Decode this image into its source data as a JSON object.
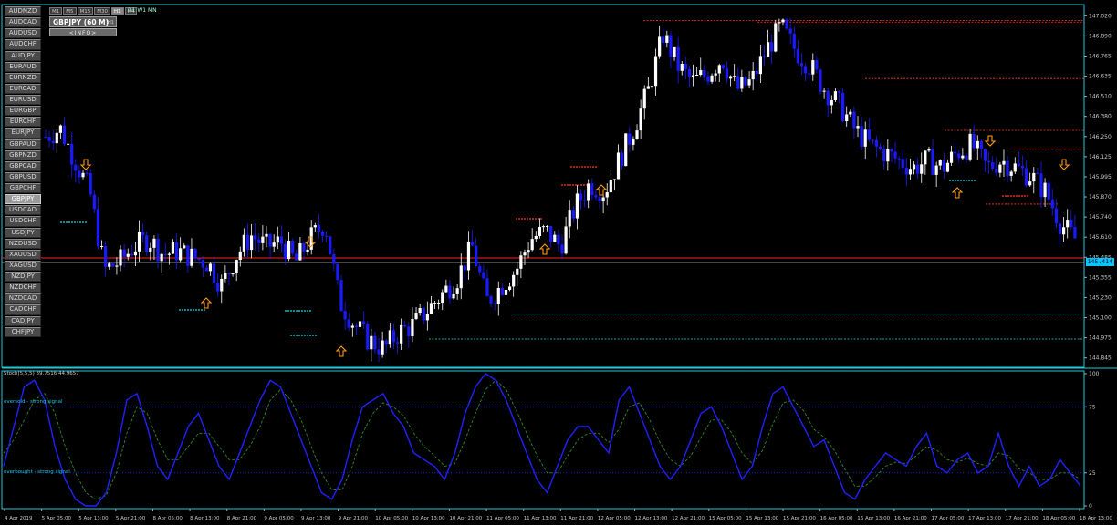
{
  "symbols": [
    "AUDNZD",
    "AUDCAD",
    "AUDUSD",
    "AUDCHF",
    "AUDJPY",
    "EURAUD",
    "EURNZD",
    "EURCAD",
    "EURUSD",
    "EURGBP",
    "EURCHF",
    "EURJPY",
    "GBPAUD",
    "GBPNZD",
    "GBPCAD",
    "GBPUSD",
    "GBPCHF",
    "GBPJPY",
    "USDCAD",
    "USDCHF",
    "USDJPY",
    "NZDUSD",
    "XAUUSD",
    "XAGUSD",
    "NZDJPY",
    "NZDCHF",
    "NZDCAD",
    "CADCHF",
    "CADJPY",
    "CHFJPY"
  ],
  "active_symbol": "GBPJPY",
  "timeframes": [
    "M1",
    "M5",
    "M15",
    "M30",
    "H1",
    "H4"
  ],
  "active_timeframe": "H1",
  "tf_extra": "D1 W1 MN",
  "title": "GBPJPY (60 M)",
  "title_small": "H1",
  "info_button": "<INFO>",
  "current_price": "145.414",
  "price_scale": [
    "147.020",
    "146.890",
    "146.765",
    "146.635",
    "146.510",
    "146.380",
    "146.250",
    "146.125",
    "145.995",
    "145.870",
    "145.740",
    "145.610",
    "145.485",
    "145.355",
    "145.230",
    "145.100",
    "144.975",
    "144.845"
  ],
  "stoch_label": "Stoch(5,5,5) 39.7516 44.9657",
  "stoch_scale": [
    "100",
    "75",
    "25",
    "0"
  ],
  "oversold_label": "oversold - strong signal",
  "overbought_label": "overbought - strong signal",
  "time_axis": [
    "4 Apr 2019",
    "5 Apr 05:00",
    "5 Apr 13:00",
    "5 Apr 21:00",
    "8 Apr 05:00",
    "8 Apr 13:00",
    "8 Apr 21:00",
    "9 Apr 05:00",
    "9 Apr 13:00",
    "9 Apr 21:00",
    "10 Apr 05:00",
    "10 Apr 13:00",
    "10 Apr 21:00",
    "11 Apr 05:00",
    "11 Apr 13:00",
    "11 Apr 21:00",
    "12 Apr 05:00",
    "12 Apr 13:00",
    "12 Apr 21:00",
    "15 Apr 05:00",
    "15 Apr 13:00",
    "15 Apr 21:00",
    "16 Apr 05:00",
    "16 Apr 13:00",
    "16 Apr 21:00",
    "17 Apr 05:00",
    "17 Apr 13:00",
    "17 Apr 21:00",
    "18 Apr 05:00",
    "18 Apr 13:00"
  ],
  "colors": {
    "background": "#000000",
    "bull": "#ffffff",
    "bear": "#1a1aff",
    "frame": "#1fc8d8",
    "grid": "#3a3a3a",
    "resistance": "#ff3a1f",
    "support": "#18d8e8",
    "arrow": "#ff9a1a",
    "stoch_main": "#2020ff",
    "stoch_signal": "#2a8a2a",
    "bid_line": "#ff2020"
  },
  "chart_data": {
    "type": "candlestick",
    "title": "GBPJPY (60 M)",
    "ylim": [
      144.78,
      147.08
    ],
    "close_trace": [
      146.25,
      146.3,
      146.1,
      145.9,
      145.4,
      145.45,
      145.55,
      145.6,
      145.5,
      145.52,
      145.48,
      145.45,
      145.3,
      145.5,
      145.62,
      145.55,
      145.58,
      145.45,
      145.6,
      145.7,
      145.2,
      145.05,
      144.95,
      144.9,
      145.0,
      145.05,
      145.15,
      145.25,
      145.35,
      145.55,
      145.2,
      145.3,
      145.4,
      145.6,
      145.65,
      145.55,
      145.8,
      145.95,
      145.9,
      146.1,
      146.3,
      146.55,
      146.9,
      146.7,
      146.6,
      146.65,
      146.75,
      146.55,
      146.6,
      146.8,
      146.95,
      146.8,
      146.7,
      146.55,
      146.45,
      146.3,
      146.2,
      146.15,
      146.1,
      146.05,
      146.1,
      146.05,
      146.15,
      146.2,
      146.05,
      146.1,
      146.05,
      146.0,
      145.9,
      145.7,
      145.6
    ],
    "stoch_main": [
      30,
      60,
      90,
      95,
      80,
      45,
      20,
      5,
      0,
      0,
      10,
      40,
      80,
      85,
      60,
      30,
      20,
      40,
      60,
      70,
      50,
      30,
      20,
      40,
      60,
      80,
      95,
      90,
      70,
      50,
      30,
      10,
      5,
      20,
      50,
      75,
      80,
      85,
      70,
      60,
      40,
      35,
      30,
      20,
      40,
      70,
      90,
      100,
      95,
      80,
      60,
      40,
      20,
      10,
      30,
      50,
      60,
      60,
      50,
      40,
      80,
      90,
      70,
      50,
      30,
      20,
      30,
      50,
      70,
      75,
      60,
      40,
      20,
      30,
      60,
      85,
      90,
      75,
      60,
      45,
      50,
      30,
      10,
      5,
      20,
      30,
      40,
      35,
      30,
      45,
      55,
      30,
      25,
      35,
      40,
      25,
      30,
      55,
      30,
      15,
      30,
      15,
      20,
      35,
      25,
      15
    ],
    "stoch_signal": [
      40,
      50,
      65,
      80,
      85,
      70,
      45,
      25,
      10,
      5,
      8,
      25,
      55,
      75,
      70,
      50,
      35,
      35,
      45,
      55,
      55,
      45,
      35,
      35,
      45,
      60,
      80,
      88,
      80,
      65,
      45,
      25,
      12,
      12,
      30,
      55,
      70,
      78,
      75,
      68,
      55,
      45,
      38,
      30,
      32,
      50,
      70,
      88,
      95,
      88,
      72,
      55,
      38,
      25,
      25,
      38,
      50,
      55,
      55,
      48,
      58,
      75,
      78,
      65,
      48,
      35,
      30,
      38,
      52,
      65,
      65,
      55,
      40,
      32,
      42,
      62,
      78,
      80,
      72,
      58,
      52,
      42,
      28,
      15,
      15,
      22,
      30,
      33,
      32,
      38,
      45,
      42,
      35,
      33,
      36,
      32,
      30,
      40,
      38,
      28,
      25,
      20,
      20,
      25,
      25,
      20
    ]
  }
}
